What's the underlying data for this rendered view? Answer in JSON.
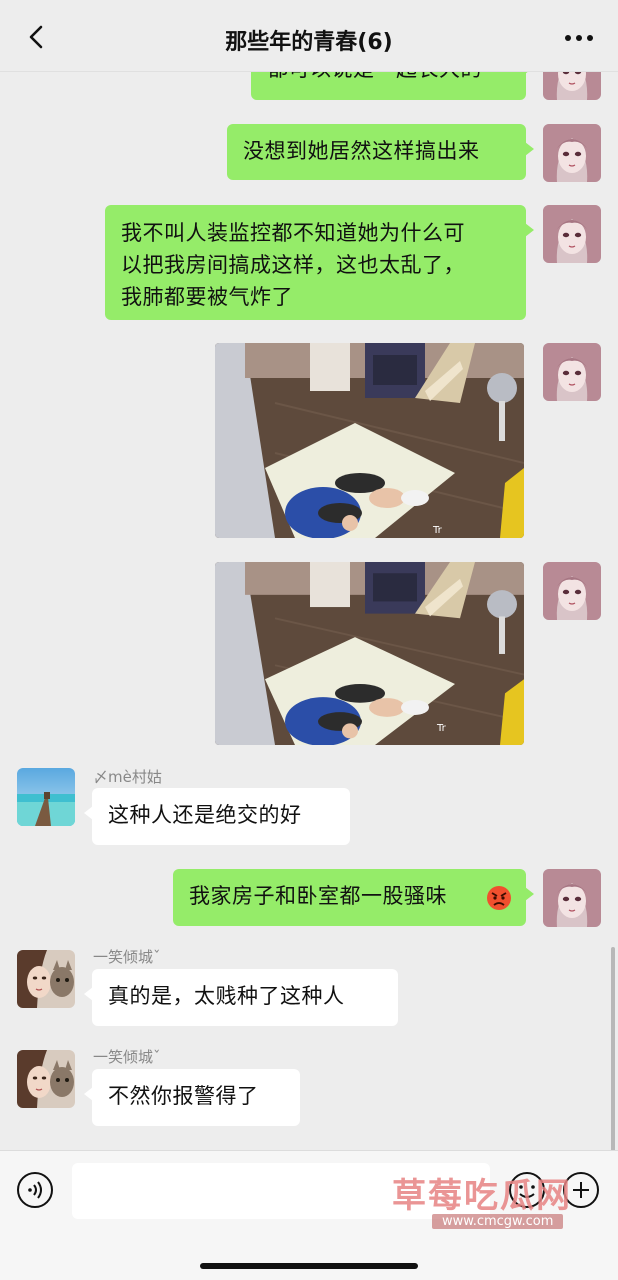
{
  "header": {
    "title": "那些年的青春(6)",
    "back_icon": "chevron-left-icon",
    "more_icon": "more-dots-icon"
  },
  "messages": [
    {
      "side": "right",
      "type": "text",
      "text": "都可以说是一起长大的"
    },
    {
      "side": "right",
      "type": "text",
      "text": "没想到她居然这样搞出来"
    },
    {
      "side": "right",
      "type": "text",
      "lines": [
        "我不叫人装监控都不知道她为什么可",
        "以把我房间搞成这样，这也太乱了，",
        "我肺都要被气炸了"
      ]
    },
    {
      "side": "right",
      "type": "image",
      "caption_mark": "Tr"
    },
    {
      "side": "right",
      "type": "image",
      "caption_mark": "Tr"
    },
    {
      "side": "left",
      "type": "text",
      "sender": "〆mè村姑",
      "text": "这种人还是绝交的好"
    },
    {
      "side": "right",
      "type": "text",
      "text": "我家房子和卧室都一股骚味",
      "emoji": "angry-face-icon"
    },
    {
      "side": "left",
      "type": "text",
      "sender": "一笑倾城ˇ",
      "text": "真的是，太贱种了这种人"
    },
    {
      "side": "left",
      "type": "text",
      "sender": "一笑倾城ˇ",
      "text": "不然你报警得了"
    }
  ],
  "input_bar": {
    "voice_icon": "voice-icon",
    "emoji_icon": "emoji-icon",
    "plus_icon": "plus-icon",
    "value": ""
  },
  "watermark": {
    "main": "草莓吃瓜网",
    "sub": "www.cmcgw.com"
  },
  "colors": {
    "background": "#ededed",
    "my_bubble": "#95ec69",
    "their_bubble": "#ffffff"
  }
}
